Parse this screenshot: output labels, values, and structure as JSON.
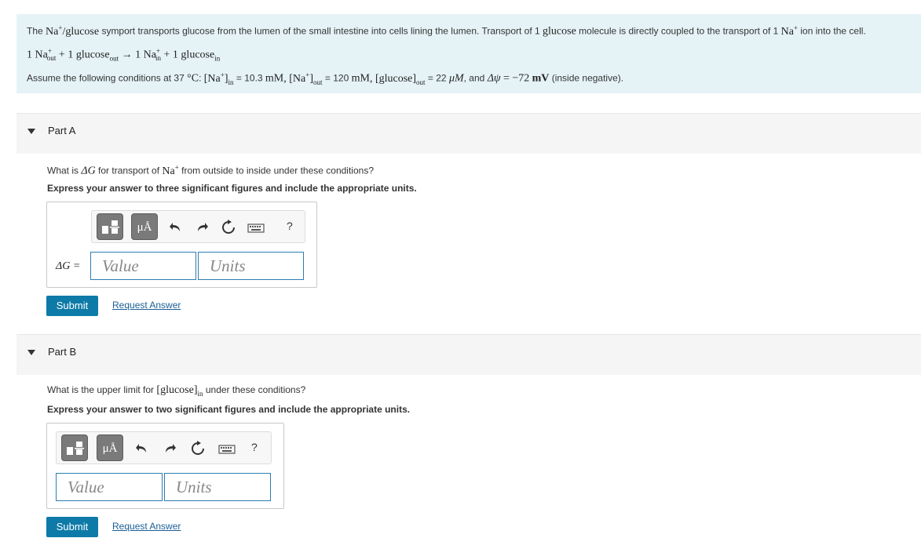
{
  "intro": {
    "l1_a": "The",
    "l1_b": "Na",
    "l1_c": "+",
    "l1_d": "/glucose",
    "l1_e": "symport transports glucose from the lumen of the small intestine into cells lining the lumen. Transport of 1",
    "l1_f": "glucose",
    "l1_g": "molecule is directly coupled to the transport of 1",
    "l1_h": "Na",
    "l1_i": "+",
    "l1_j": "ion into the cell.",
    "eq_1": "1 Na",
    "eq_2": "+",
    "eq_3": "out",
    "eq_4": "+ 1 glucose",
    "eq_5": "out",
    "eq_6": "→ 1 Na",
    "eq_7": "+",
    "eq_8": "in",
    "eq_9": "+ 1 glucose",
    "eq_10": "in",
    "l3_a": "Assume the following conditions at 37",
    "l3_b": "°C",
    "l3_c": ":",
    "l3_d": "[Na",
    "l3_e": "+",
    "l3_f": "]",
    "l3_g": "in",
    "l3_h": "= 10.3",
    "l3_i": "mM",
    "l3_j": ", [Na",
    "l3_k": "+",
    "l3_l": "]",
    "l3_m": "out",
    "l3_n": "= 120",
    "l3_o": "mM",
    "l3_p": ", [glucose]",
    "l3_q": "out",
    "l3_r": "= 22",
    "l3_s": "μM",
    "l3_t": ", and",
    "l3_u": "Δψ",
    "l3_v": "= −72",
    "l3_w": "mV",
    "l3_x": "(inside negative)."
  },
  "partA": {
    "title": "Part A",
    "q_a": "What is",
    "q_b": "ΔG",
    "q_c": "for transport of",
    "q_d": "Na",
    "q_e": "+",
    "q_f": "from outside to inside under these conditions?",
    "instruction": "Express your answer to three significant figures and include the appropriate units.",
    "label": "ΔG =",
    "value_placeholder": "Value",
    "units_placeholder": "Units",
    "units_btn": "μÅ",
    "help": "?",
    "submit": "Submit",
    "request": "Request Answer"
  },
  "partB": {
    "title": "Part B",
    "q_a": "What is the upper limit for",
    "q_b": "[glucose]",
    "q_c": "in",
    "q_d": "under these conditions?",
    "instruction": "Express your answer to two significant figures and include the appropriate units.",
    "value_placeholder": "Value",
    "units_placeholder": "Units",
    "units_btn": "μÅ",
    "help": "?",
    "submit": "Submit",
    "request": "Request Answer"
  },
  "colors": {
    "intro_bg": "#e5f3f7",
    "submit_bg": "#0e7aa8",
    "link": "#1a5e96",
    "field_border": "#2b7db3"
  }
}
